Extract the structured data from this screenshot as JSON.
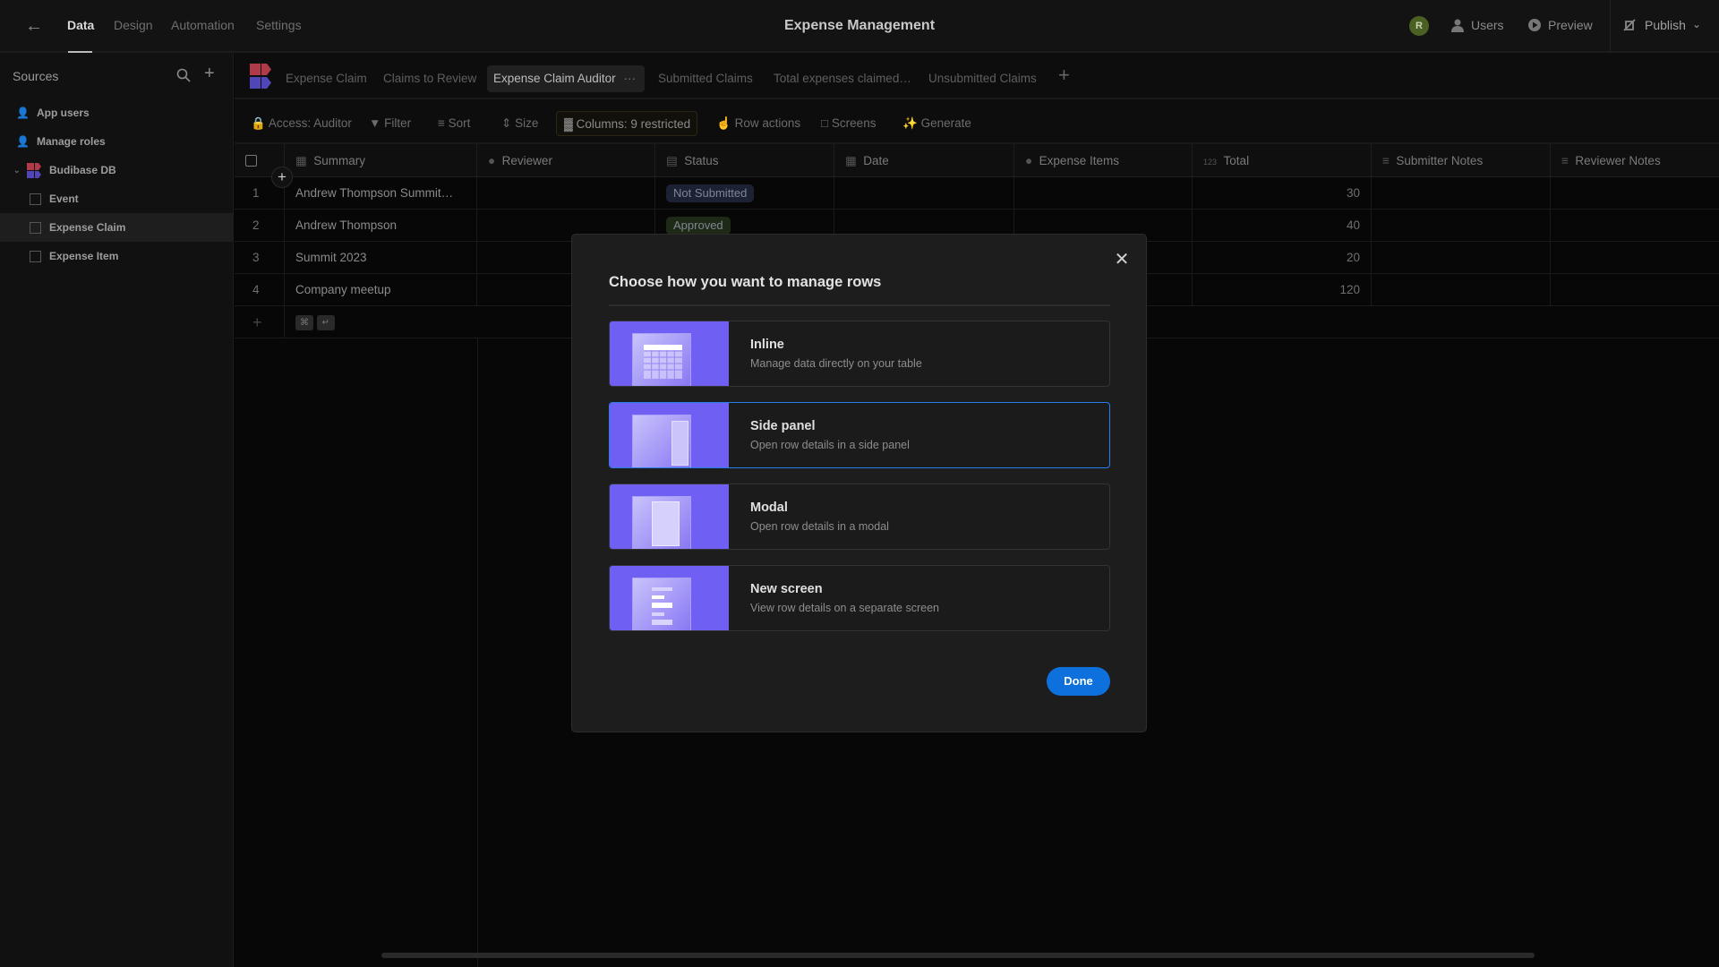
{
  "topbar": {
    "nav": [
      "Data",
      "Design",
      "Automation",
      "Settings"
    ],
    "active_nav": "Data",
    "title": "Expense Management",
    "avatar_initial": "R",
    "users": "Users",
    "preview": "Preview",
    "publish": "Publish"
  },
  "sidebar": {
    "heading": "Sources",
    "items": [
      "App users",
      "Manage roles",
      "Budibase DB",
      "Event",
      "Expense Claim",
      "Expense Item"
    ],
    "selected": "Expense Claim"
  },
  "tabs": {
    "items": [
      "Expense Claim",
      "Claims to Review",
      "Expense Claim Auditor",
      "Submitted Claims",
      "Total expenses claimed…",
      "Unsubmitted Claims"
    ],
    "active": "Expense Claim Auditor"
  },
  "toolbar": {
    "access": "Access: Auditor",
    "filter": "Filter",
    "sort": "Sort",
    "size": "Size",
    "columns": "Columns: 9 restricted",
    "row_actions": "Row actions",
    "screens": "Screens",
    "generate": "Generate"
  },
  "table": {
    "columns": [
      "Summary",
      "Reviewer",
      "Status",
      "Date",
      "Expense Items",
      "Total",
      "Submitter Notes",
      "Reviewer Notes"
    ],
    "total_prefix": "123",
    "rows": [
      {
        "n": "1",
        "summary": "Andrew Thompson Summit…",
        "status": "Not Submitted",
        "total": "30"
      },
      {
        "n": "2",
        "summary": "Andrew Thompson",
        "status": "Approved",
        "total": "40"
      },
      {
        "n": "3",
        "summary": "Summit 2023",
        "status": "",
        "total": "20"
      },
      {
        "n": "4",
        "summary": "Company meetup",
        "status": "",
        "total": "120"
      }
    ],
    "status_colors": {
      "Not Submitted": "#1c2233",
      "Approved": "#1f2a16"
    }
  },
  "modal": {
    "title": "Choose how you want to manage rows",
    "options": [
      {
        "title": "Inline",
        "desc": "Manage data directly on your table"
      },
      {
        "title": "Side panel",
        "desc": "Open row details in a side panel"
      },
      {
        "title": "Modal",
        "desc": "Open row details in a modal"
      },
      {
        "title": "New screen",
        "desc": "View row details on a separate screen"
      }
    ],
    "selected": "Side panel",
    "done": "Done",
    "accent": "#6f5ff2"
  }
}
